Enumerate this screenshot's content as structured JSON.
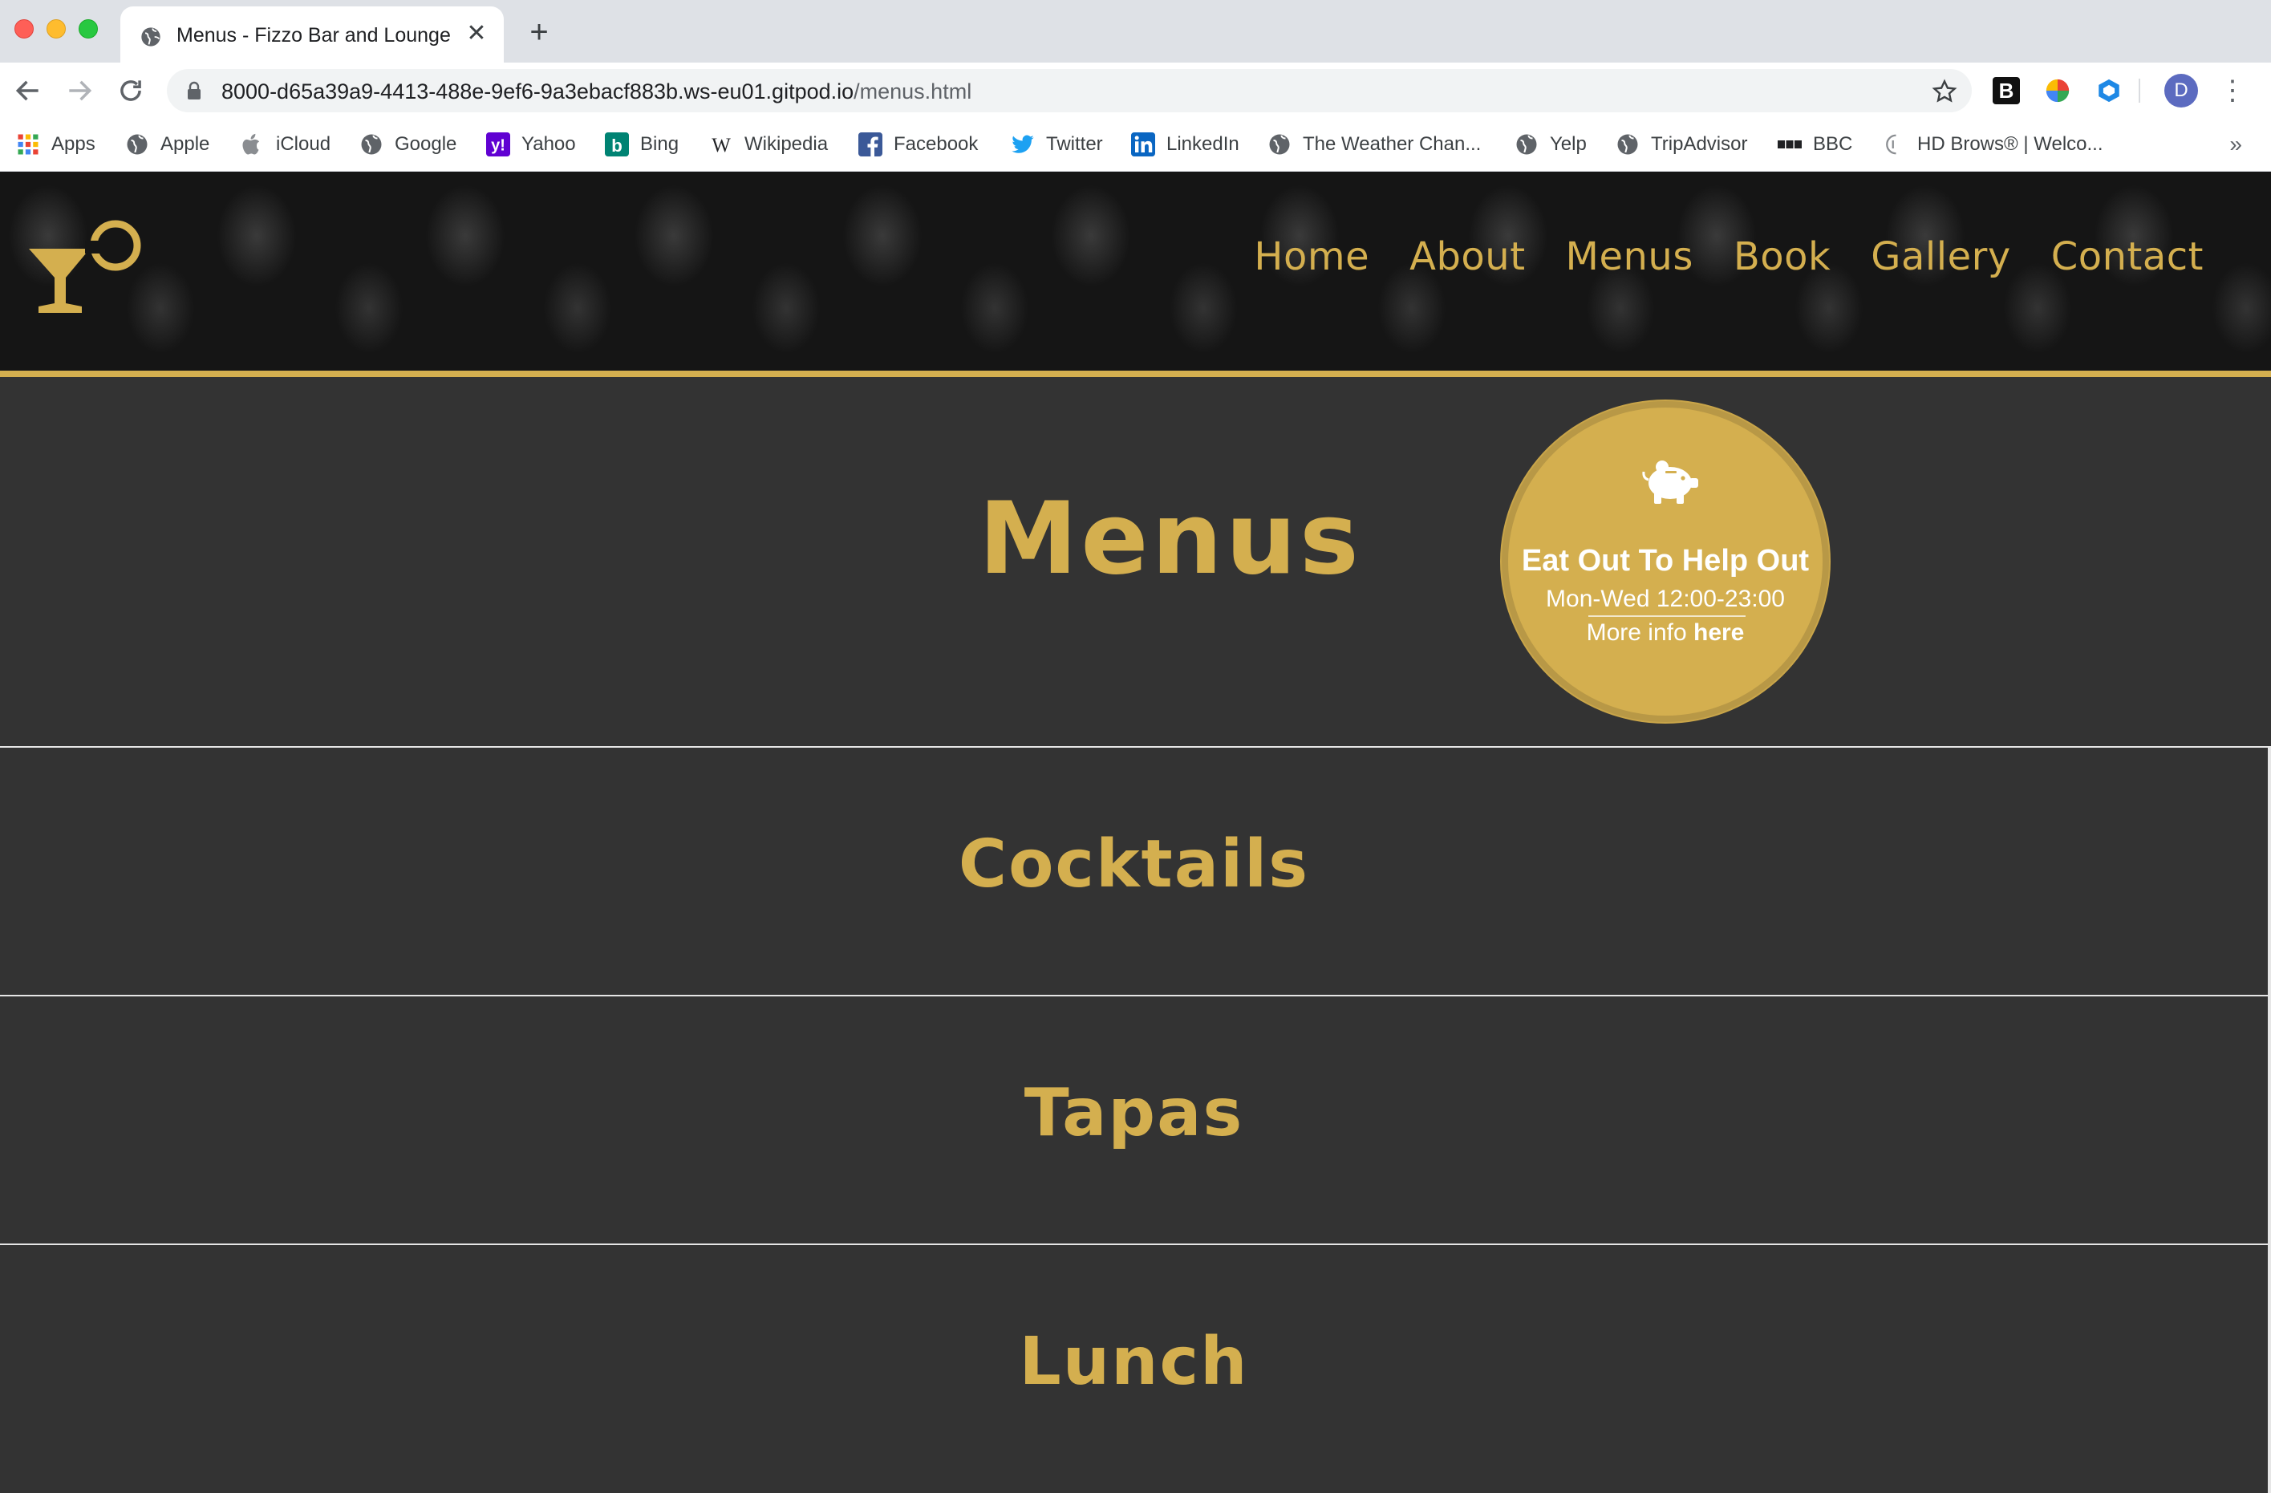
{
  "browser": {
    "tab_title": "Menus - Fizzo Bar and Lounge",
    "url_host": "8000-d65a39a9-4413-488e-9ef6-9a3ebacf883b.ws-eu01.gitpod.io",
    "url_path": "/menus.html",
    "profile_initial": "D",
    "ext_b_label": "B",
    "bookmarks": [
      {
        "label": "Apps",
        "icon": "apps-grid-icon"
      },
      {
        "label": "Apple",
        "icon": "globe-icon"
      },
      {
        "label": "iCloud",
        "icon": "apple-icon"
      },
      {
        "label": "Google",
        "icon": "globe-icon"
      },
      {
        "label": "Yahoo",
        "icon": "yahoo-icon"
      },
      {
        "label": "Bing",
        "icon": "bing-icon"
      },
      {
        "label": "Wikipedia",
        "icon": "wikipedia-icon"
      },
      {
        "label": "Facebook",
        "icon": "facebook-icon"
      },
      {
        "label": "Twitter",
        "icon": "twitter-icon"
      },
      {
        "label": "LinkedIn",
        "icon": "linkedin-icon"
      },
      {
        "label": "The Weather Chan...",
        "icon": "globe-icon"
      },
      {
        "label": "Yelp",
        "icon": "globe-icon"
      },
      {
        "label": "TripAdvisor",
        "icon": "globe-icon"
      },
      {
        "label": "BBC",
        "icon": "bbc-icon"
      },
      {
        "label": "HD Brows® | Welco...",
        "icon": "hd-brows-icon"
      }
    ],
    "bookmarks_overflow": "»"
  },
  "site": {
    "nav": [
      "Home",
      "About",
      "Menus",
      "Book",
      "Gallery",
      "Contact"
    ],
    "page_title": "Menus",
    "promo": {
      "title": "Eat Out To Help Out",
      "hours": "Mon-Wed 12:00-23:00",
      "info_prefix": "More info ",
      "info_link": "here",
      "icon": "piggy-bank-icon"
    },
    "sections": [
      "Cocktails",
      "Tapas",
      "Lunch"
    ]
  },
  "colors": {
    "gold": "#d4af4f",
    "page_bg": "#333333",
    "header_bg": "#151515"
  }
}
